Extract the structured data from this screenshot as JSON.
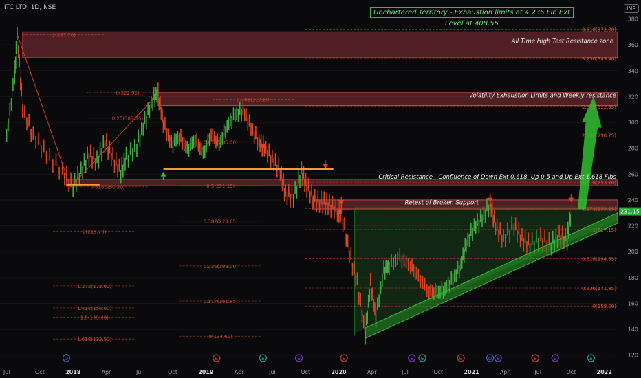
{
  "header": {
    "symbol": "ITC LTD, 1D, NSE",
    "currency": "INR"
  },
  "banner": "Unchartered Territory - Exhaustion limits at 4.236 Fib Ext Level at 408.55",
  "colors": {
    "up": "#3cae3c",
    "down": "#e0401e",
    "fib": "#d0402a",
    "zone": "#8a3236",
    "orange": "#f59a38",
    "green": "#30c030",
    "triangle": "#2f8f2f",
    "price_tag": "#26a637",
    "bg": "#0a0a0c"
  },
  "chart_data": {
    "type": "line",
    "title": "ITC LTD, 1D, NSE",
    "xlabel": "",
    "ylabel": "INR",
    "ylim": [
      114,
      384
    ],
    "x_ticks": [
      "Jul",
      "Oct",
      "2018",
      "Apr",
      "Jul",
      "Oct",
      "2019",
      "Apr",
      "Jul",
      "Oct",
      "2020",
      "Apr",
      "Jul",
      "Oct",
      "2021",
      "Apr",
      "Jul",
      "Oct",
      "2022"
    ],
    "y_ticks": [
      120,
      140,
      160,
      180,
      200,
      220,
      240,
      260,
      280,
      300,
      320,
      340,
      360,
      380
    ],
    "last_price": "231.15",
    "series": [
      {
        "values": [
          [
            2017.5,
            290
          ],
          [
            2017.56,
            335
          ],
          [
            2017.58,
            368
          ],
          [
            2017.62,
            310
          ],
          [
            2017.7,
            290
          ],
          [
            2017.8,
            275
          ],
          [
            2017.92,
            262
          ],
          [
            2018.0,
            250
          ],
          [
            2018.06,
            262
          ],
          [
            2018.12,
            275
          ],
          [
            2018.18,
            270
          ],
          [
            2018.24,
            285
          ],
          [
            2018.3,
            272
          ],
          [
            2018.36,
            262
          ],
          [
            2018.4,
            272
          ],
          [
            2018.48,
            282
          ],
          [
            2018.54,
            300
          ],
          [
            2018.6,
            318
          ],
          [
            2018.64,
            322
          ],
          [
            2018.68,
            300
          ],
          [
            2018.74,
            282
          ],
          [
            2018.8,
            290
          ],
          [
            2018.86,
            278
          ],
          [
            2018.92,
            288
          ],
          [
            2018.98,
            275
          ],
          [
            2019.04,
            292
          ],
          [
            2019.1,
            282
          ],
          [
            2019.16,
            298
          ],
          [
            2019.22,
            305
          ],
          [
            2019.28,
            310
          ],
          [
            2019.34,
            295
          ],
          [
            2019.4,
            285
          ],
          [
            2019.44,
            280
          ],
          [
            2019.5,
            272
          ],
          [
            2019.56,
            262
          ],
          [
            2019.6,
            245
          ],
          [
            2019.66,
            242
          ],
          [
            2019.72,
            262
          ],
          [
            2019.76,
            250
          ],
          [
            2019.82,
            240
          ],
          [
            2019.88,
            238
          ],
          [
            2019.93,
            236
          ],
          [
            2019.99,
            232
          ],
          [
            2020.02,
            230
          ],
          [
            2020.08,
            200
          ],
          [
            2020.14,
            175
          ],
          [
            2020.2,
            137
          ],
          [
            2020.24,
            175
          ],
          [
            2020.28,
            150
          ],
          [
            2020.34,
            185
          ],
          [
            2020.38,
            190
          ],
          [
            2020.46,
            195
          ],
          [
            2020.54,
            190
          ],
          [
            2020.6,
            180
          ],
          [
            2020.68,
            170
          ],
          [
            2020.74,
            168
          ],
          [
            2020.8,
            172
          ],
          [
            2020.86,
            178
          ],
          [
            2020.92,
            190
          ],
          [
            2020.96,
            205
          ],
          [
            2021.02,
            220
          ],
          [
            2021.08,
            225
          ],
          [
            2021.14,
            238
          ],
          [
            2021.18,
            220
          ],
          [
            2021.24,
            210
          ],
          [
            2021.32,
            220
          ],
          [
            2021.38,
            210
          ],
          [
            2021.44,
            205
          ],
          [
            2021.52,
            210
          ],
          [
            2021.6,
            206
          ],
          [
            2021.66,
            212
          ],
          [
            2021.72,
            210
          ],
          [
            2021.75,
            231
          ]
        ]
      }
    ],
    "annotations": [
      {
        "text": "All Time High Test Resistance zone",
        "y": 363
      },
      {
        "text": "Volatility Exhaustion Limits and Weekly resistance",
        "y": 321
      },
      {
        "text": "Critical Resistance - Confluence of Down Ext 0.618, Up 0.5 and Up Ext 1.618 Fibs",
        "y": 258
      },
      {
        "text": "Retest of Broken Support",
        "y": 238
      }
    ],
    "fib_labels_left": [
      "1(367.70)",
      "0(322.95)",
      "0.786(317.80)",
      "0.25(303.35)",
      "0.618(285.00)",
      "0.618(250.20)",
      "0.5(251.15)",
      "0.382(223.65)",
      "0(215.70)",
      "0.236(189.00)",
      "1.272(173.60)",
      "0.117(161.85)",
      "1.414(156.60)",
      "1.5(149.40)",
      "0(134.60)",
      "1.618(132.50)"
    ],
    "fib_labels_right": [
      "3.618(372.00)",
      "3.236(349.40)",
      "2.618(312.35)",
      "2.236(290.25)",
      "1.618(253.70)",
      "1.272(233.25)",
      "1(217.15)",
      "0.618(194.55)",
      "0.236(171.95)",
      "0(158.00)"
    ],
    "event_markers": [
      "D",
      "E",
      "E",
      "E",
      "E",
      "E",
      "E",
      "E",
      "D",
      "E",
      "E",
      "E",
      "E"
    ]
  }
}
